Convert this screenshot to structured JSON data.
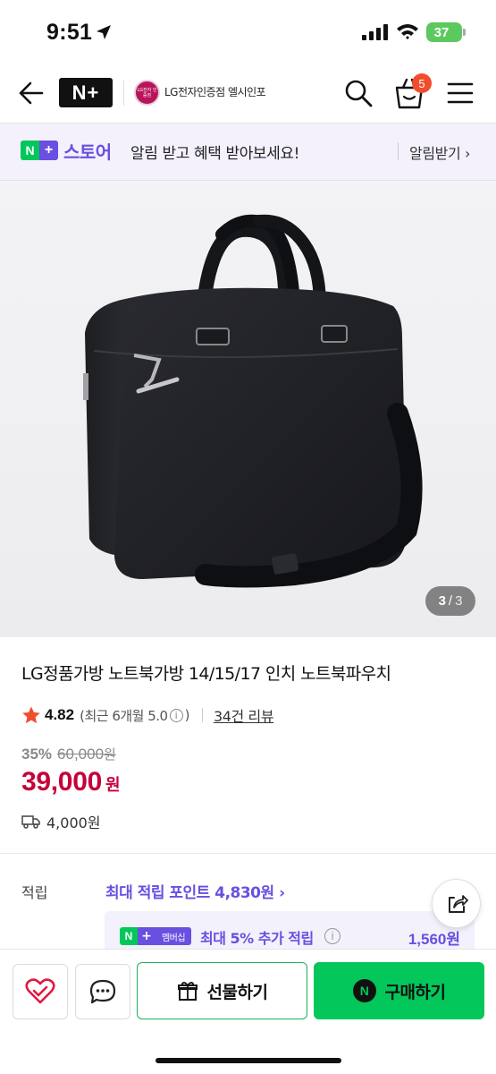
{
  "status_bar": {
    "time": "9:51",
    "battery": "37"
  },
  "header": {
    "nplus_label": "N+",
    "store_logo_text": "LG전자 인증점",
    "store_name": "LG전자인증점 엘시인포",
    "cart_count": "5"
  },
  "banner": {
    "logo": "N+",
    "store_label": "스토어",
    "text": "알림 받고 혜택 받아보세요!",
    "action": "알림받기 ›"
  },
  "gallery": {
    "current": "3",
    "separator": "/",
    "total": "3"
  },
  "product": {
    "title": "LG정품가방 노트북가방 14/15/17 인치 노트북파우치",
    "rating": "4.82",
    "recent_rating": "(최근 6개월 5.0",
    "recent_close": ")",
    "review_count": "34건 리뷰",
    "discount_pct": "35%",
    "original_price": "60,000",
    "original_won": "원",
    "price": "39,000",
    "price_won": "원",
    "shipping": "4,000원"
  },
  "points": {
    "label": "적립",
    "max_points": "최대 적립 포인트 4,830원 ›",
    "member_badge": "멤버십",
    "member_text": "최대 5% 추가 적립",
    "member_amount": "1,560원"
  },
  "bottom_bar": {
    "gift_label": "선물하기",
    "buy_label": "구매하기"
  },
  "colors": {
    "naver_green": "#03c75a",
    "plus_purple": "#6a4fe0",
    "price_red": "#c5003a",
    "badge_orange": "#f04d2e"
  }
}
